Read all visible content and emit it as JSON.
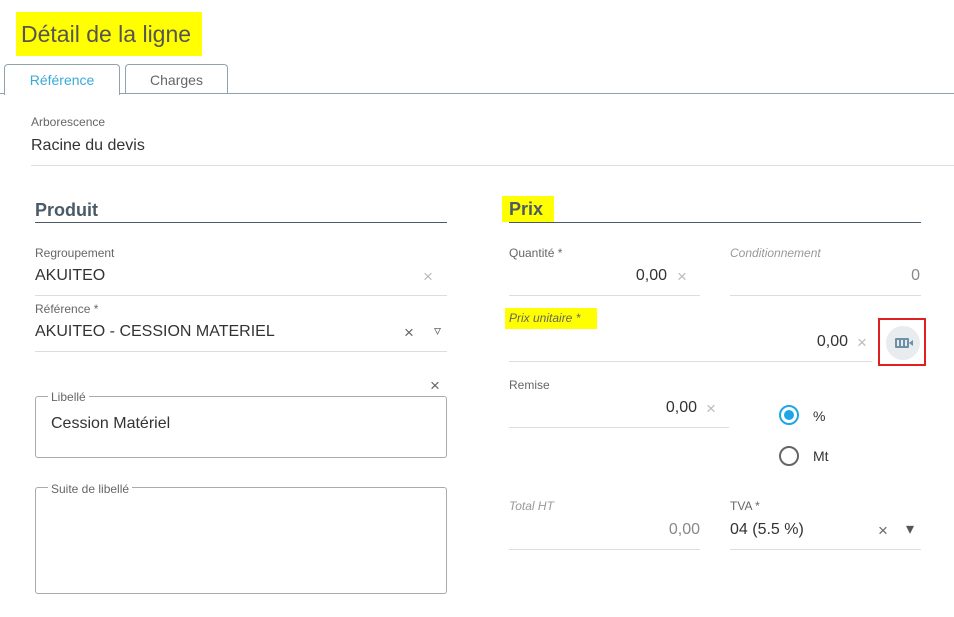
{
  "page": {
    "title": "Détail de la ligne"
  },
  "tabs": [
    {
      "label": "Référence",
      "active": true
    },
    {
      "label": "Charges",
      "active": false
    }
  ],
  "tree": {
    "label": "Arborescence",
    "value": "Racine du devis"
  },
  "produit": {
    "title": "Produit",
    "regroupement": {
      "label": "Regroupement",
      "value": "AKUITEO"
    },
    "reference": {
      "label": "Référence *",
      "value": "AKUITEO - CESSION MATERIEL"
    },
    "libelle": {
      "label": "Libellé",
      "value": "Cession Matériel"
    },
    "suite": {
      "label": "Suite de libellé",
      "value": ""
    }
  },
  "prix": {
    "title": "Prix",
    "quantite": {
      "label": "Quantité *",
      "value": "0,00"
    },
    "conditionnement": {
      "label": "Conditionnement",
      "value": "0"
    },
    "prix_unitaire": {
      "label": "Prix unitaire *",
      "value": "0,00"
    },
    "remise": {
      "label": "Remise",
      "value": "0,00"
    },
    "remise_options": [
      {
        "label": "%",
        "selected": true
      },
      {
        "label": "Mt",
        "selected": false
      }
    ],
    "total_ht": {
      "label": "Total HT",
      "value": "0,00"
    },
    "tva": {
      "label": "TVA *",
      "value": "04 (5.5 %)"
    }
  },
  "icons": {
    "clear": "×",
    "dropdown_outline": "▿",
    "dropdown_filled": "▾",
    "calculator": "calculator-icon"
  },
  "colors": {
    "highlight": "#ffff00",
    "active_tab": "#3aa9d8",
    "radio_selected": "#1ea7e6",
    "calc_box_border": "#e02020"
  }
}
